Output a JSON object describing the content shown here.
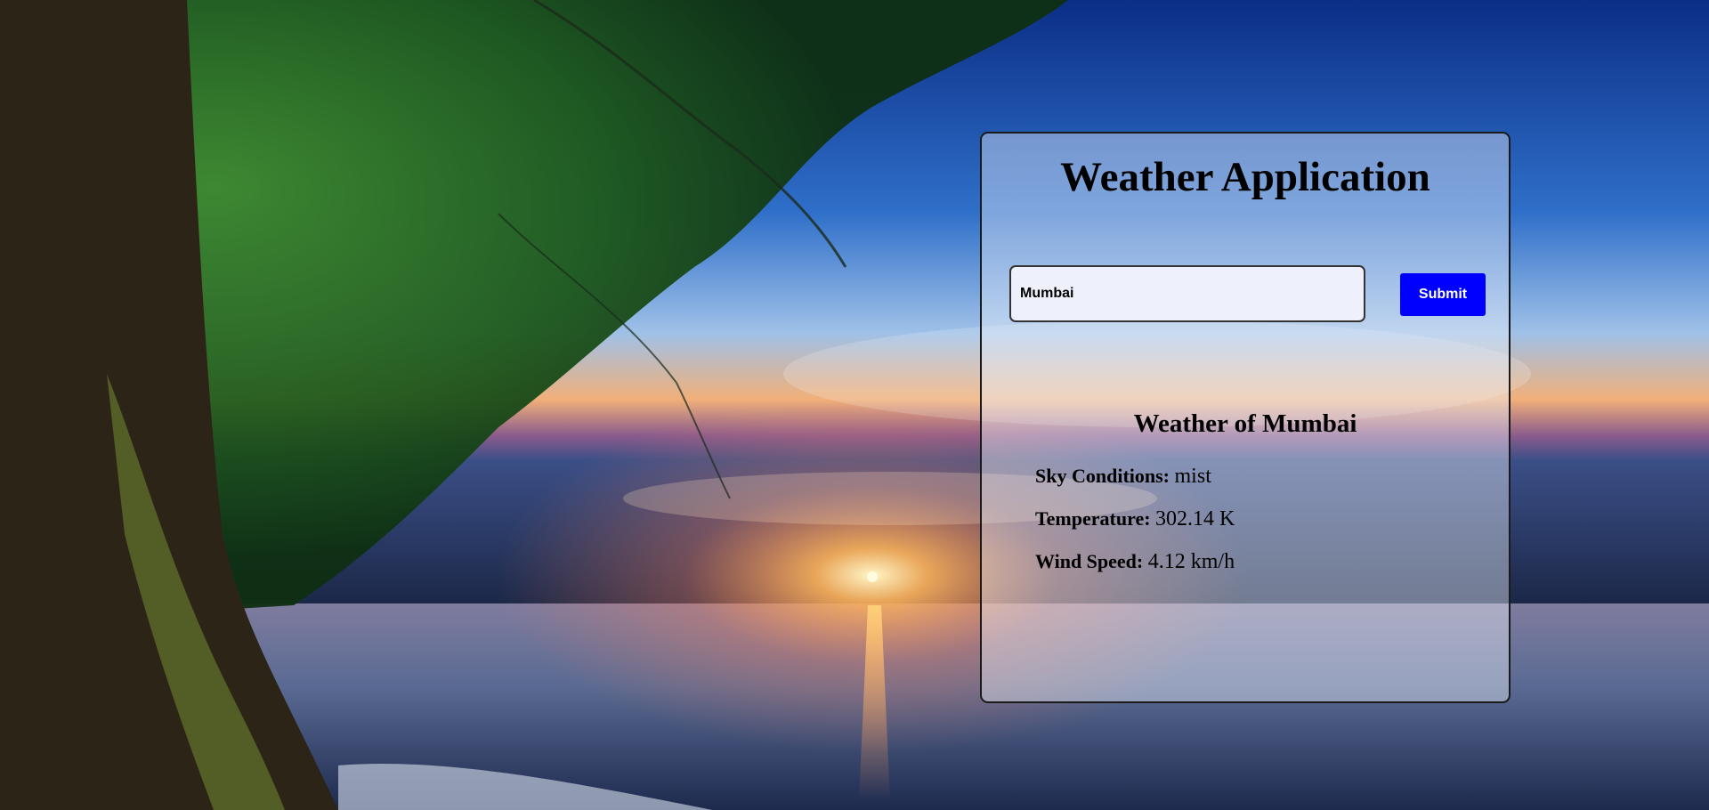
{
  "app": {
    "title": "Weather Application"
  },
  "search": {
    "value": "Mumbai",
    "submit_label": "Submit"
  },
  "result": {
    "heading": "Weather of Mumbai",
    "rows": [
      {
        "label": "Sky Conditions:",
        "value": "mist"
      },
      {
        "label": "Temperature:",
        "value": "302.14 K"
      },
      {
        "label": "Wind Speed:",
        "value": "4.12 km/h"
      }
    ]
  },
  "colors": {
    "submit_bg": "#0000ff",
    "submit_text": "#ffffff",
    "input_bg": "#eef0fb"
  }
}
